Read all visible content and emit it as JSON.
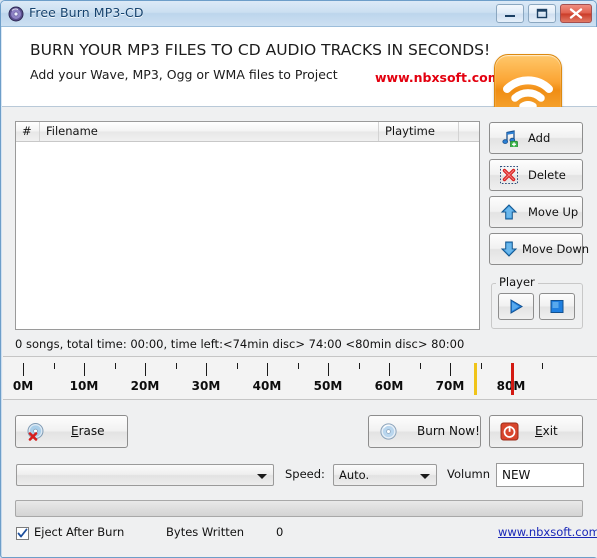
{
  "window": {
    "title": "Free Burn MP3-CD",
    "icon": "cd-disc-icon",
    "controls": {
      "minimize": "minimize-icon",
      "maximize": "maximize-icon",
      "close": "close-icon"
    }
  },
  "header": {
    "headline": "BURN YOUR MP3 FILES TO CD AUDIO TRACKS IN SECONDS!",
    "subline": "Add your Wave, MP3, Ogg or WMA files to Project",
    "url": "www.nbxsoft.com",
    "url_color": "#e3000f",
    "logo": "wifi-signal-icon"
  },
  "file_list": {
    "columns": [
      {
        "label": "#"
      },
      {
        "label": "Filename"
      },
      {
        "label": "Playtime"
      },
      {
        "label": ""
      }
    ],
    "rows": []
  },
  "status": {
    "summary": "0 songs, total time: 00:00, time left:<74min disc> 74:00 <80min disc> 80:00"
  },
  "side_buttons": [
    {
      "label": "Add",
      "icon": "music-note-add-icon"
    },
    {
      "label": "Delete",
      "icon": "red-x-delete-icon"
    },
    {
      "label": "Move Up",
      "icon": "blue-arrow-up-icon"
    },
    {
      "label": "Move Down",
      "icon": "blue-arrow-down-icon"
    }
  ],
  "player": {
    "legend": "Player",
    "play": "play-icon",
    "stop": "stop-icon"
  },
  "ruler": {
    "labels": [
      "0M",
      "10M",
      "20M",
      "30M",
      "40M",
      "50M",
      "60M",
      "70M",
      "80M"
    ],
    "marker_74min_color": "#f0c419",
    "marker_80min_color": "#d31a12"
  },
  "actions": {
    "erase": {
      "label_pre": "",
      "accel": "E",
      "label_post": "rase",
      "icon": "disc-erase-icon"
    },
    "burn": {
      "label": "Burn Now!",
      "icon": "disc-burn-icon"
    },
    "exit": {
      "label_pre": "",
      "accel": "E",
      "label_post": "xit",
      "icon": "power-exit-icon"
    }
  },
  "controls": {
    "drive_combo": {
      "value": "",
      "options": []
    },
    "speed_label": "Speed:",
    "speed_combo": {
      "value": "Auto.",
      "options": [
        "Auto."
      ]
    },
    "volume_label": "Volumn",
    "volume_input": {
      "value": "NEW",
      "placeholder": ""
    }
  },
  "progress": {
    "percent": 0
  },
  "footer": {
    "eject_label": "Eject After Burn",
    "eject_checked": true,
    "bytes_label": "Bytes Written",
    "bytes_value": "0",
    "url": "www.nbxsoft.com"
  }
}
